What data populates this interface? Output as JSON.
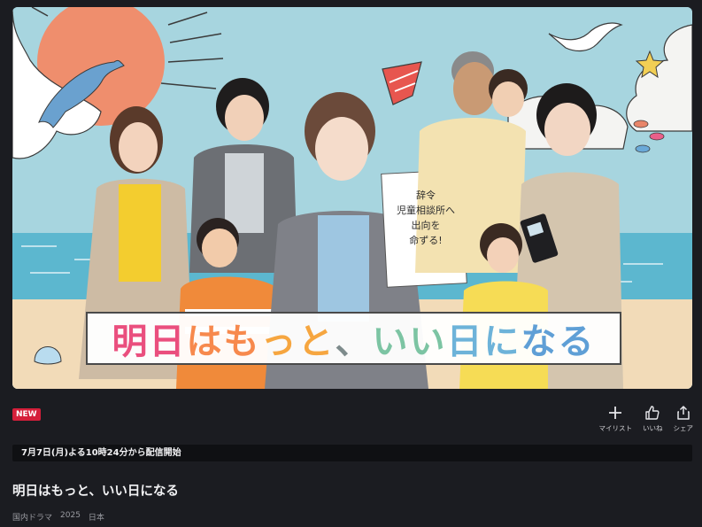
{
  "hero": {
    "title_chars": [
      "明",
      "日",
      "は",
      "も",
      "っ",
      "と",
      "、",
      "い",
      "い",
      "日",
      "に",
      "な",
      "る"
    ],
    "title_colors": [
      "#ea4f7e",
      "#ea4f7e",
      "#f7894d",
      "#f7894d",
      "#f6a640",
      "#f6a640",
      "#7e8b8c",
      "#7cc4a3",
      "#7cc4a3",
      "#6db3d9",
      "#6db3d9",
      "#5f9fd6",
      "#5f9fd6"
    ],
    "sign_lines": [
      "辞令",
      "児童相談所へ",
      "出向を",
      "命ずる!"
    ]
  },
  "badge": {
    "label": "NEW",
    "color": "#d51f3a"
  },
  "actions": [
    {
      "label": "マイリスト",
      "icon": "plus-icon"
    },
    {
      "label": "いいね",
      "icon": "thumbs-up-icon"
    },
    {
      "label": "シェア",
      "icon": "share-icon"
    }
  ],
  "notice": {
    "text": "7月7日(月)よる10時24分から配信開始"
  },
  "show": {
    "title": "明日はもっと、いい日になる",
    "genre": "国内ドラマ",
    "year": "2025",
    "country": "日本"
  }
}
